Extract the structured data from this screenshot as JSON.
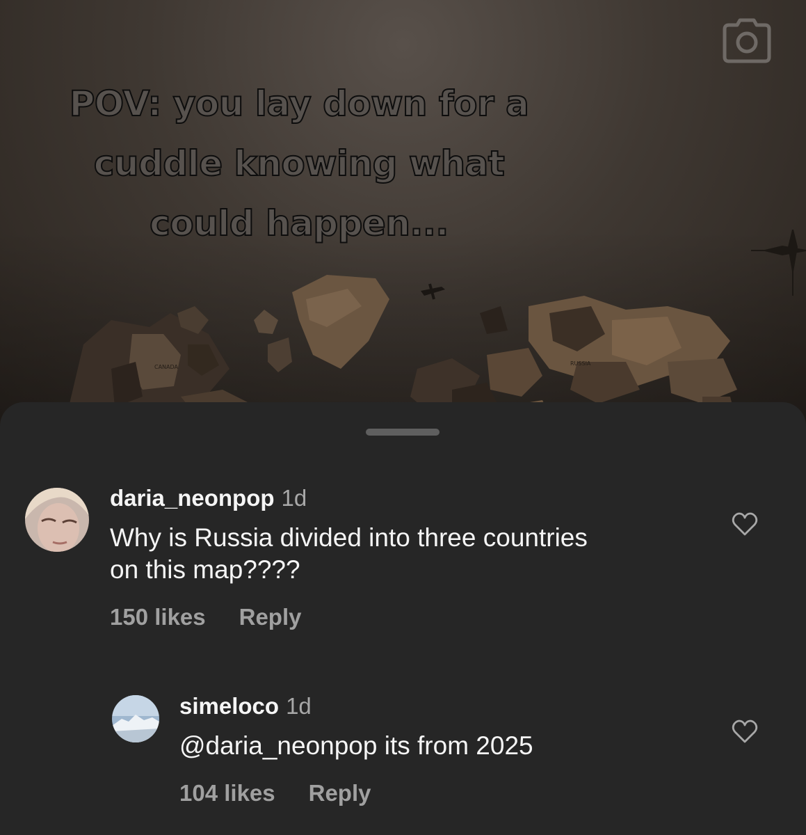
{
  "video": {
    "caption": "POV: you lay down for a\ncuddle knowing what\ncould happen...",
    "map_labels": [
      "CANADA",
      "RUSSIA"
    ]
  },
  "comments": [
    {
      "username": "daria_neonpop",
      "time": "1d",
      "text": "Why is Russia divided into three countries\non this map????",
      "likes": "150 likes",
      "reply_label": "Reply"
    },
    {
      "username": "simeloco",
      "time": "1d",
      "text": "@daria_neonpop its from 2025",
      "likes": "104 likes",
      "reply_label": "Reply"
    }
  ],
  "icons": {
    "camera": "camera-icon",
    "like": "heart-outline-icon"
  },
  "colors": {
    "sheet_bg": "#262626",
    "text_primary": "#f5f5f5",
    "text_secondary": "#a0a0a0"
  }
}
